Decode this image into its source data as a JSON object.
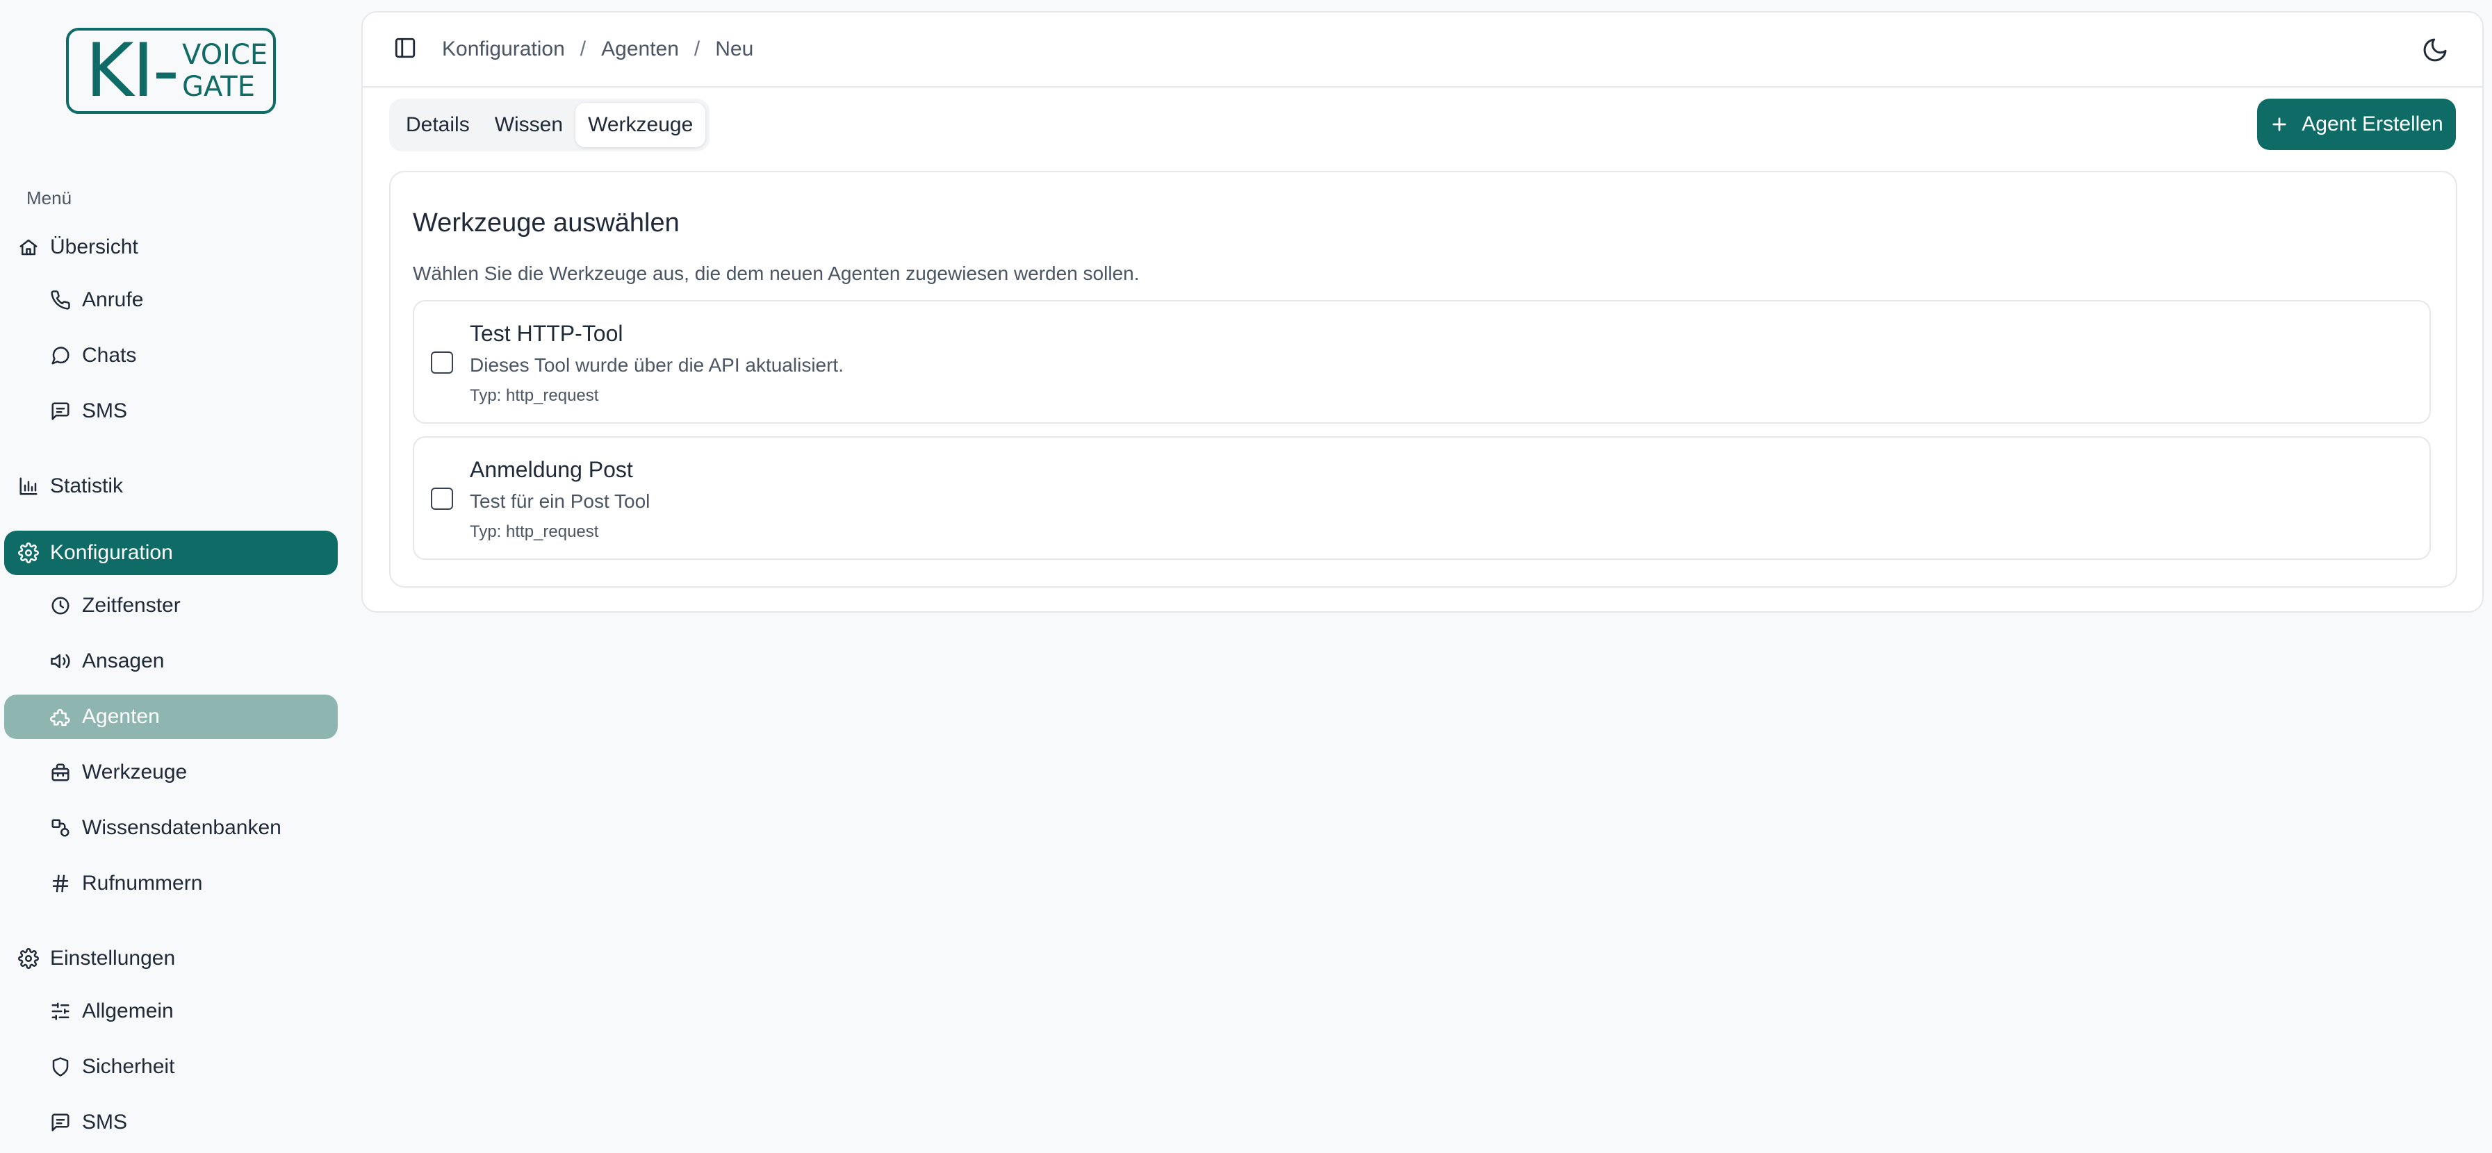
{
  "logo": {
    "big": "KI-",
    "line1": "VOICE",
    "line2": "GATE"
  },
  "sidebar": {
    "menu_label": "Menü",
    "items": [
      {
        "label": "Übersicht",
        "icon": "home-icon"
      },
      {
        "label": "Anrufe",
        "icon": "phone-icon"
      },
      {
        "label": "Chats",
        "icon": "message-circle-icon"
      },
      {
        "label": "SMS",
        "icon": "message-square-icon"
      },
      {
        "label": "Statistik",
        "icon": "bar-chart-icon"
      },
      {
        "label": "Konfiguration",
        "icon": "gear-icon"
      },
      {
        "label": "Zeitfenster",
        "icon": "clock-icon"
      },
      {
        "label": "Ansagen",
        "icon": "speaker-icon"
      },
      {
        "label": "Agenten",
        "icon": "puzzle-icon"
      },
      {
        "label": "Werkzeuge",
        "icon": "toolbox-icon"
      },
      {
        "label": "Wissensdatenbanken",
        "icon": "shapes-icon"
      },
      {
        "label": "Rufnummern",
        "icon": "hash-icon"
      },
      {
        "label": "Einstellungen",
        "icon": "gear-icon"
      },
      {
        "label": "Allgemein",
        "icon": "sliders-icon"
      },
      {
        "label": "Sicherheit",
        "icon": "shield-icon"
      },
      {
        "label": "SMS",
        "icon": "message-square-icon"
      }
    ]
  },
  "header": {
    "breadcrumb": [
      "Konfiguration",
      "Agenten",
      "Neu"
    ],
    "separator": "/"
  },
  "tabs": [
    "Details",
    "Wissen",
    "Werkzeuge"
  ],
  "create_button": "Agent Erstellen",
  "section": {
    "title": "Werkzeuge auswählen",
    "description": "Wählen Sie die Werkzeuge aus, die dem neuen Agenten zugewiesen werden sollen.",
    "tools": [
      {
        "name": "Test HTTP-Tool",
        "description": "Dieses Tool wurde über die API aktualisiert.",
        "type": "Typ: http_request"
      },
      {
        "name": "Anmeldung Post",
        "description": "Test für ein Post Tool",
        "type": "Typ: http_request"
      }
    ]
  },
  "colors": {
    "accent": "#0f6b66",
    "selected": "#8fb5b1",
    "border": "#e5e7eb",
    "background": "#f8f9fb"
  }
}
